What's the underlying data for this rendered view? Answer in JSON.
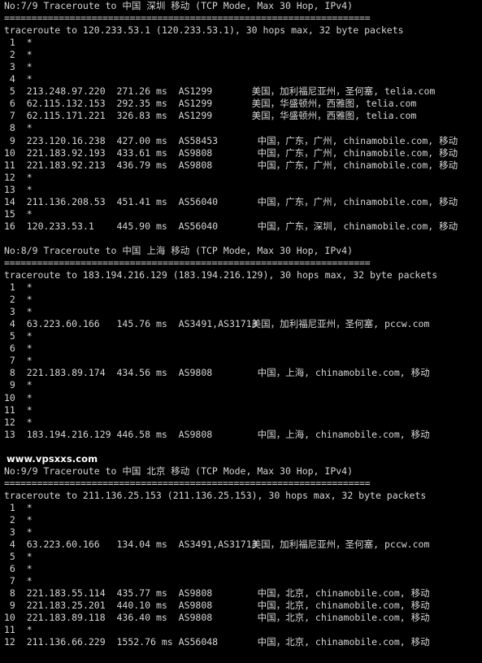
{
  "terminal": {
    "background_color": "#000000",
    "text_color": "#d6d6d6",
    "watermark": "www.vpsxxs.com",
    "separator": "===================================================================",
    "star": "*",
    "blocks": [
      {
        "header": "No:7/9 Traceroute to 中国 深圳 移动 (TCP Mode, Max 30 Hop, IPv4)",
        "command": "traceroute to 120.233.53.1 (120.233.53.1), 30 hops max, 32 byte packets",
        "hops": [
          {
            "num": "1",
            "timeout": true
          },
          {
            "num": "2",
            "timeout": true
          },
          {
            "num": "3",
            "timeout": true
          },
          {
            "num": "4",
            "timeout": true
          },
          {
            "num": "5",
            "ip": "213.248.97.220",
            "rtt": "271.26 ms",
            "asn": "AS1299",
            "geo": "美国，加利福尼亚州，圣何塞, telia.com"
          },
          {
            "num": "6",
            "ip": "62.115.132.153",
            "rtt": "292.35 ms",
            "asn": "AS1299",
            "geo": "美国，华盛顿州，西雅图, telia.com"
          },
          {
            "num": "7",
            "ip": "62.115.171.221",
            "rtt": "326.83 ms",
            "asn": "AS1299",
            "geo": "美国，华盛顿州，西雅图, telia.com"
          },
          {
            "num": "8",
            "timeout": true
          },
          {
            "num": "9",
            "ip": "223.120.16.238",
            "rtt": "427.00 ms",
            "asn": "AS58453",
            "geo": " 中国，广东，广州, chinamobile.com, 移动"
          },
          {
            "num": "10",
            "ip": "221.183.92.193",
            "rtt": "433.61 ms",
            "asn": "AS9808",
            "geo": " 中国，广东，广州, chinamobile.com, 移动"
          },
          {
            "num": "11",
            "ip": "221.183.92.213",
            "rtt": "436.79 ms",
            "asn": "AS9808",
            "geo": " 中国，广东，广州, chinamobile.com, 移动"
          },
          {
            "num": "12",
            "timeout": true
          },
          {
            "num": "13",
            "timeout": true
          },
          {
            "num": "14",
            "ip": "211.136.208.53",
            "rtt": "451.41 ms",
            "asn": "AS56040",
            "geo": " 中国，广东，广州, chinamobile.com, 移动"
          },
          {
            "num": "15",
            "timeout": true
          },
          {
            "num": "16",
            "ip": "120.233.53.1",
            "rtt": "445.90 ms",
            "asn": "AS56040",
            "geo": " 中国，广东，深圳, chinamobile.com, 移动"
          }
        ]
      },
      {
        "header": "No:8/9 Traceroute to 中国 上海 移动 (TCP Mode, Max 30 Hop, IPv4)",
        "command": "traceroute to 183.194.216.129 (183.194.216.129), 30 hops max, 32 byte packets",
        "hops": [
          {
            "num": "1",
            "timeout": true
          },
          {
            "num": "2",
            "timeout": true
          },
          {
            "num": "3",
            "timeout": true
          },
          {
            "num": "4",
            "ip": "63.223.60.166",
            "rtt": "145.76 ms",
            "asn": "AS3491,AS31713",
            "geo": "美国，加利福尼亚州，圣何塞, pccw.com"
          },
          {
            "num": "5",
            "timeout": true
          },
          {
            "num": "6",
            "timeout": true
          },
          {
            "num": "7",
            "timeout": true
          },
          {
            "num": "8",
            "ip": "221.183.89.174",
            "rtt": "434.56 ms",
            "asn": "AS9808",
            "geo": " 中国，上海, chinamobile.com, 移动"
          },
          {
            "num": "9",
            "timeout": true
          },
          {
            "num": "10",
            "timeout": true
          },
          {
            "num": "11",
            "timeout": true
          },
          {
            "num": "12",
            "timeout": true
          },
          {
            "num": "13",
            "ip": "183.194.216.129",
            "rtt": "446.58 ms",
            "asn": "AS9808",
            "geo": " 中国，上海, chinamobile.com, 移动"
          }
        ]
      },
      {
        "header": "No:9/9 Traceroute to 中国 北京 移动 (TCP Mode, Max 30 Hop, IPv4)",
        "command": "traceroute to 211.136.25.153 (211.136.25.153), 30 hops max, 32 byte packets",
        "hops": [
          {
            "num": "1",
            "timeout": true
          },
          {
            "num": "2",
            "timeout": true
          },
          {
            "num": "3",
            "timeout": true
          },
          {
            "num": "4",
            "ip": "63.223.60.166",
            "rtt": "134.04 ms",
            "asn": "AS3491,AS31713",
            "geo": "美国，加利福尼亚州，圣何塞, pccw.com"
          },
          {
            "num": "5",
            "timeout": true
          },
          {
            "num": "6",
            "timeout": true
          },
          {
            "num": "7",
            "timeout": true
          },
          {
            "num": "8",
            "ip": "221.183.55.114",
            "rtt": "435.77 ms",
            "asn": "AS9808",
            "geo": " 中国，北京, chinamobile.com, 移动"
          },
          {
            "num": "9",
            "ip": "221.183.25.201",
            "rtt": "440.10 ms",
            "asn": "AS9808",
            "geo": " 中国，北京, chinamobile.com, 移动"
          },
          {
            "num": "10",
            "ip": "221.183.89.118",
            "rtt": "436.40 ms",
            "asn": "AS9808",
            "geo": " 中国，北京, chinamobile.com, 移动"
          },
          {
            "num": "11",
            "timeout": true
          },
          {
            "num": "12",
            "ip": "211.136.66.229",
            "rtt": "1552.76 ms",
            "asn": "AS56048",
            "geo": " 中国，北京, chinamobile.com, 移动"
          }
        ]
      }
    ]
  }
}
